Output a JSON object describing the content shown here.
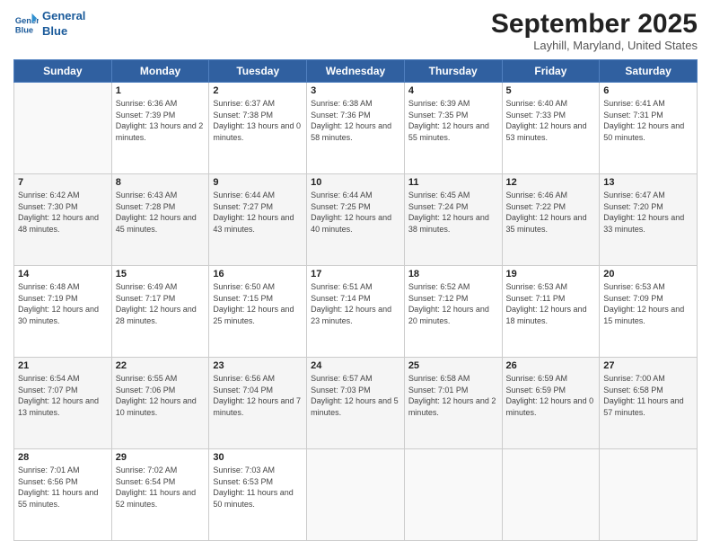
{
  "header": {
    "logo_line1": "General",
    "logo_line2": "Blue",
    "month": "September 2025",
    "location": "Layhill, Maryland, United States"
  },
  "weekdays": [
    "Sunday",
    "Monday",
    "Tuesday",
    "Wednesday",
    "Thursday",
    "Friday",
    "Saturday"
  ],
  "weeks": [
    [
      {
        "day": "",
        "sunrise": "",
        "sunset": "",
        "daylight": "",
        "empty": true
      },
      {
        "day": "1",
        "sunrise": "Sunrise: 6:36 AM",
        "sunset": "Sunset: 7:39 PM",
        "daylight": "Daylight: 13 hours and 2 minutes."
      },
      {
        "day": "2",
        "sunrise": "Sunrise: 6:37 AM",
        "sunset": "Sunset: 7:38 PM",
        "daylight": "Daylight: 13 hours and 0 minutes."
      },
      {
        "day": "3",
        "sunrise": "Sunrise: 6:38 AM",
        "sunset": "Sunset: 7:36 PM",
        "daylight": "Daylight: 12 hours and 58 minutes."
      },
      {
        "day": "4",
        "sunrise": "Sunrise: 6:39 AM",
        "sunset": "Sunset: 7:35 PM",
        "daylight": "Daylight: 12 hours and 55 minutes."
      },
      {
        "day": "5",
        "sunrise": "Sunrise: 6:40 AM",
        "sunset": "Sunset: 7:33 PM",
        "daylight": "Daylight: 12 hours and 53 minutes."
      },
      {
        "day": "6",
        "sunrise": "Sunrise: 6:41 AM",
        "sunset": "Sunset: 7:31 PM",
        "daylight": "Daylight: 12 hours and 50 minutes."
      }
    ],
    [
      {
        "day": "7",
        "sunrise": "Sunrise: 6:42 AM",
        "sunset": "Sunset: 7:30 PM",
        "daylight": "Daylight: 12 hours and 48 minutes."
      },
      {
        "day": "8",
        "sunrise": "Sunrise: 6:43 AM",
        "sunset": "Sunset: 7:28 PM",
        "daylight": "Daylight: 12 hours and 45 minutes."
      },
      {
        "day": "9",
        "sunrise": "Sunrise: 6:44 AM",
        "sunset": "Sunset: 7:27 PM",
        "daylight": "Daylight: 12 hours and 43 minutes."
      },
      {
        "day": "10",
        "sunrise": "Sunrise: 6:44 AM",
        "sunset": "Sunset: 7:25 PM",
        "daylight": "Daylight: 12 hours and 40 minutes."
      },
      {
        "day": "11",
        "sunrise": "Sunrise: 6:45 AM",
        "sunset": "Sunset: 7:24 PM",
        "daylight": "Daylight: 12 hours and 38 minutes."
      },
      {
        "day": "12",
        "sunrise": "Sunrise: 6:46 AM",
        "sunset": "Sunset: 7:22 PM",
        "daylight": "Daylight: 12 hours and 35 minutes."
      },
      {
        "day": "13",
        "sunrise": "Sunrise: 6:47 AM",
        "sunset": "Sunset: 7:20 PM",
        "daylight": "Daylight: 12 hours and 33 minutes."
      }
    ],
    [
      {
        "day": "14",
        "sunrise": "Sunrise: 6:48 AM",
        "sunset": "Sunset: 7:19 PM",
        "daylight": "Daylight: 12 hours and 30 minutes."
      },
      {
        "day": "15",
        "sunrise": "Sunrise: 6:49 AM",
        "sunset": "Sunset: 7:17 PM",
        "daylight": "Daylight: 12 hours and 28 minutes."
      },
      {
        "day": "16",
        "sunrise": "Sunrise: 6:50 AM",
        "sunset": "Sunset: 7:15 PM",
        "daylight": "Daylight: 12 hours and 25 minutes."
      },
      {
        "day": "17",
        "sunrise": "Sunrise: 6:51 AM",
        "sunset": "Sunset: 7:14 PM",
        "daylight": "Daylight: 12 hours and 23 minutes."
      },
      {
        "day": "18",
        "sunrise": "Sunrise: 6:52 AM",
        "sunset": "Sunset: 7:12 PM",
        "daylight": "Daylight: 12 hours and 20 minutes."
      },
      {
        "day": "19",
        "sunrise": "Sunrise: 6:53 AM",
        "sunset": "Sunset: 7:11 PM",
        "daylight": "Daylight: 12 hours and 18 minutes."
      },
      {
        "day": "20",
        "sunrise": "Sunrise: 6:53 AM",
        "sunset": "Sunset: 7:09 PM",
        "daylight": "Daylight: 12 hours and 15 minutes."
      }
    ],
    [
      {
        "day": "21",
        "sunrise": "Sunrise: 6:54 AM",
        "sunset": "Sunset: 7:07 PM",
        "daylight": "Daylight: 12 hours and 13 minutes."
      },
      {
        "day": "22",
        "sunrise": "Sunrise: 6:55 AM",
        "sunset": "Sunset: 7:06 PM",
        "daylight": "Daylight: 12 hours and 10 minutes."
      },
      {
        "day": "23",
        "sunrise": "Sunrise: 6:56 AM",
        "sunset": "Sunset: 7:04 PM",
        "daylight": "Daylight: 12 hours and 7 minutes."
      },
      {
        "day": "24",
        "sunrise": "Sunrise: 6:57 AM",
        "sunset": "Sunset: 7:03 PM",
        "daylight": "Daylight: 12 hours and 5 minutes."
      },
      {
        "day": "25",
        "sunrise": "Sunrise: 6:58 AM",
        "sunset": "Sunset: 7:01 PM",
        "daylight": "Daylight: 12 hours and 2 minutes."
      },
      {
        "day": "26",
        "sunrise": "Sunrise: 6:59 AM",
        "sunset": "Sunset: 6:59 PM",
        "daylight": "Daylight: 12 hours and 0 minutes."
      },
      {
        "day": "27",
        "sunrise": "Sunrise: 7:00 AM",
        "sunset": "Sunset: 6:58 PM",
        "daylight": "Daylight: 11 hours and 57 minutes."
      }
    ],
    [
      {
        "day": "28",
        "sunrise": "Sunrise: 7:01 AM",
        "sunset": "Sunset: 6:56 PM",
        "daylight": "Daylight: 11 hours and 55 minutes."
      },
      {
        "day": "29",
        "sunrise": "Sunrise: 7:02 AM",
        "sunset": "Sunset: 6:54 PM",
        "daylight": "Daylight: 11 hours and 52 minutes."
      },
      {
        "day": "30",
        "sunrise": "Sunrise: 7:03 AM",
        "sunset": "Sunset: 6:53 PM",
        "daylight": "Daylight: 11 hours and 50 minutes."
      },
      {
        "day": "",
        "sunrise": "",
        "sunset": "",
        "daylight": "",
        "empty": true
      },
      {
        "day": "",
        "sunrise": "",
        "sunset": "",
        "daylight": "",
        "empty": true
      },
      {
        "day": "",
        "sunrise": "",
        "sunset": "",
        "daylight": "",
        "empty": true
      },
      {
        "day": "",
        "sunrise": "",
        "sunset": "",
        "daylight": "",
        "empty": true
      }
    ]
  ]
}
